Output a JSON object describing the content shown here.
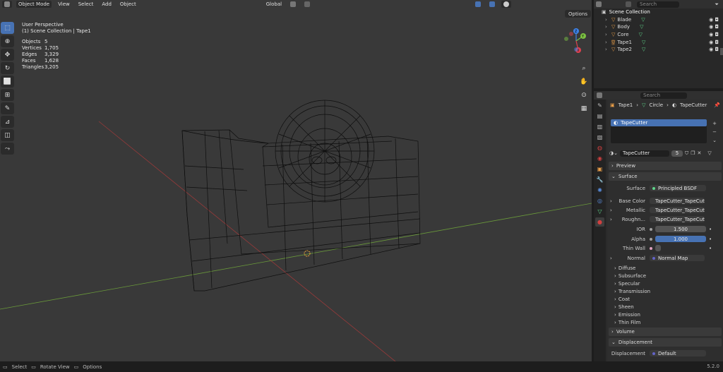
{
  "viewport": {
    "mode_label": "Object Mode",
    "menu": [
      "View",
      "Select",
      "Add",
      "Object"
    ],
    "transform_orientation": "Global",
    "options_label": "Options",
    "perspective": "User Perspective",
    "collection_path": "(1) Scene Collection | Tape1",
    "stats": [
      {
        "label": "Objects",
        "value": "5"
      },
      {
        "label": "Vertices",
        "value": "1,705"
      },
      {
        "label": "Edges",
        "value": "3,329"
      },
      {
        "label": "Faces",
        "value": "1,628"
      },
      {
        "label": "Triangles",
        "value": "3,205"
      }
    ],
    "gizmo_labels": {
      "z": "Z",
      "y": "Y",
      "x": "X"
    },
    "tools": [
      "select-box-icon",
      "cursor-icon",
      "move-icon",
      "rotate-icon",
      "scale-icon",
      "transform-icon",
      "annotate-icon",
      "measure-icon",
      "add-cube-icon",
      "shear-icon"
    ]
  },
  "outliner": {
    "search_placeholder": "Search",
    "root": "Scene Collection",
    "items": [
      {
        "name": "Blade"
      },
      {
        "name": "Body"
      },
      {
        "name": "Core"
      },
      {
        "name": "Tape1"
      },
      {
        "name": "Tape2"
      }
    ]
  },
  "properties": {
    "search_placeholder": "Search",
    "breadcrumb": [
      "Tape1",
      "Circle",
      "TapeCutter"
    ],
    "material_slot": "TapeCutter",
    "material_name": "TapeCutter",
    "user_count": "5",
    "panels": {
      "preview": "Preview",
      "surface": "Surface",
      "volume": "Volume",
      "displacement": "Displacement"
    },
    "surface_rows": [
      {
        "label": "Surface",
        "value": "Principled BSDF"
      },
      {
        "label": "Base Color",
        "value": "TapeCutter_TapeCutt..."
      },
      {
        "label": "Metallic",
        "value": "TapeCutter_TapeCutt..."
      },
      {
        "label": "Roughn...",
        "value": "TapeCutter_TapeCutt..."
      },
      {
        "label": "IOR",
        "value": "1.500"
      },
      {
        "label": "Alpha",
        "value": "1.000"
      },
      {
        "label": "Thin Wall",
        "value": ""
      },
      {
        "label": "Normal",
        "value": "Normal Map"
      }
    ],
    "subpanels": [
      "Diffuse",
      "Subsurface",
      "Specular",
      "Transmission",
      "Coat",
      "Sheen",
      "Emission",
      "Thin Film"
    ],
    "displacement_row": {
      "label": "Displacement",
      "value": "Default"
    }
  },
  "statusbar": {
    "items": [
      "Select",
      "Rotate View",
      "Options"
    ],
    "version": "5.2.0"
  },
  "colors": {
    "accent": "#4772b3",
    "object_orange": "#e89d48",
    "mesh_green": "#5fd68a",
    "x_axis": "#e0414e",
    "y_axis": "#7cc242",
    "z_axis": "#3f83e8"
  }
}
